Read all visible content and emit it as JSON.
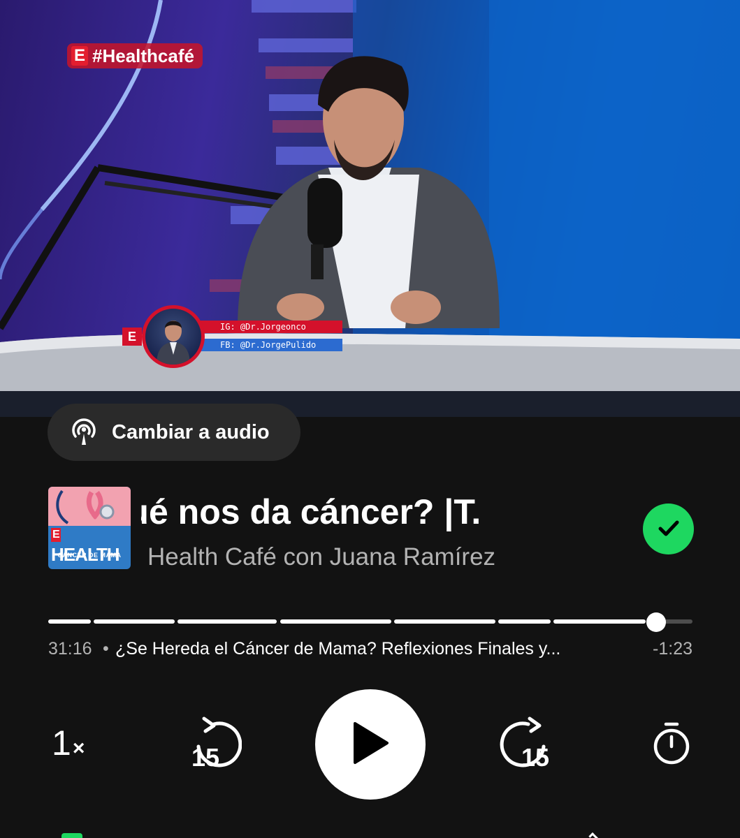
{
  "video": {
    "channel_logo": "E",
    "channel_tag": "#Healthcafé",
    "lower_third": {
      "logo": "E",
      "instagram": "IG: @Dr.Jorgeonco",
      "facebook": "FB: @Dr.JorgePulido"
    }
  },
  "switch_audio": {
    "label": "Cambiar a audio",
    "icon": "podcast-icon"
  },
  "now_playing": {
    "cover": {
      "brand_logo": "E",
      "brand_title": "HEALTH",
      "subtitle": "CÁNCER DE MAMA"
    },
    "title": "¿Porqué nos da cáncer? |T.",
    "show": "Health Café con Juana Ramírez",
    "saved": true,
    "saved_icon": "checkmark-icon",
    "accent_color": "#1ed760"
  },
  "progress": {
    "fraction": 0.944,
    "chapter_boundaries": [
      0.068,
      0.198,
      0.357,
      0.358,
      0.535,
      0.696,
      0.782,
      0.93
    ],
    "elapsed": "31:16",
    "separator": "•",
    "chapter": "¿Se Hereda el Cáncer de Mama? Reflexiones Finales y...",
    "remaining": "-1:23"
  },
  "controls": {
    "speed_value": "1",
    "speed_unit": "×",
    "skip_back_seconds": "15",
    "skip_forward_seconds": "15",
    "play_icon": "play-icon",
    "sleep_timer_icon": "timer-icon"
  }
}
